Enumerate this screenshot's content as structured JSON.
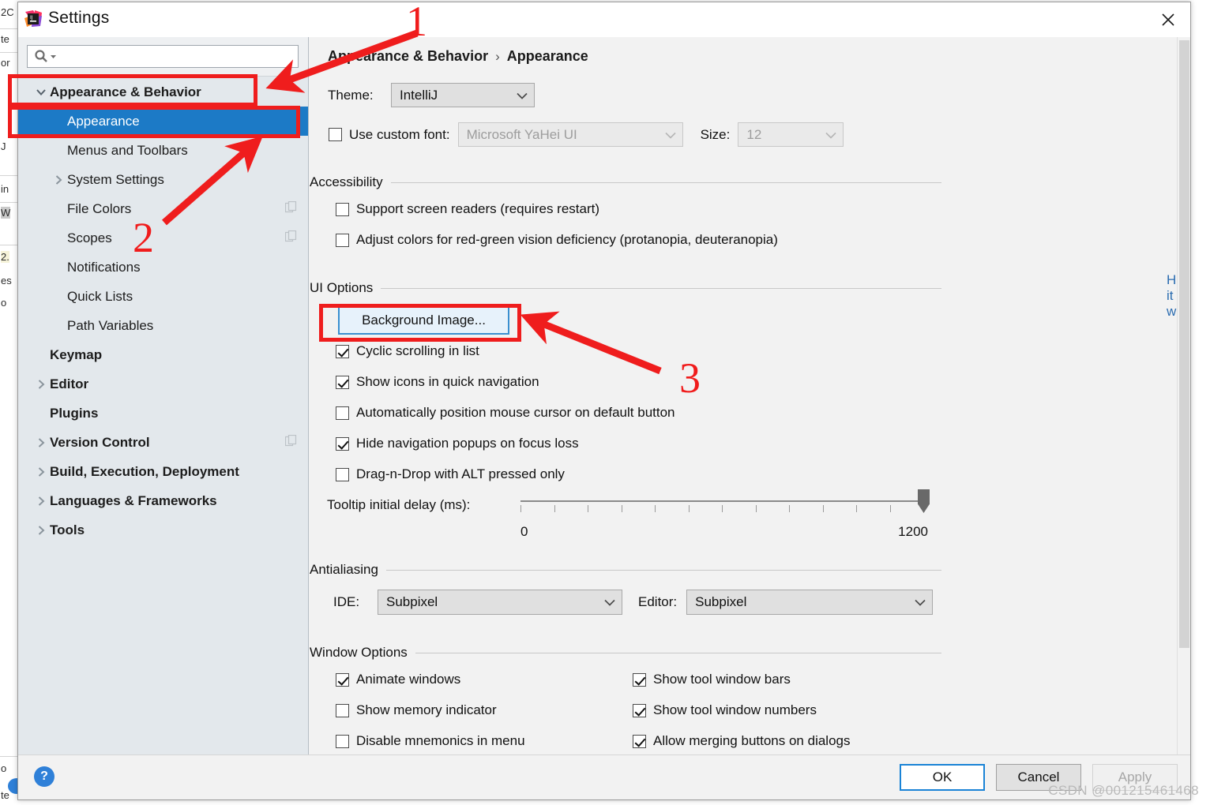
{
  "window": {
    "title": "Settings",
    "logo_icon": "intellij-idea-logo",
    "close_icon": "close-icon"
  },
  "search": {
    "value": "",
    "placeholder": "",
    "icon": "search-icon",
    "dropdown_icon": "chevron-down-icon"
  },
  "sidebar": {
    "items": [
      {
        "label": "Appearance & Behavior",
        "level": 1,
        "twisty": "expanded",
        "bold": true,
        "selected": false,
        "copy_icon": false
      },
      {
        "label": "Appearance",
        "level": 2,
        "twisty": "none",
        "bold": false,
        "selected": true,
        "copy_icon": false
      },
      {
        "label": "Menus and Toolbars",
        "level": 2,
        "twisty": "none",
        "bold": false,
        "selected": false,
        "copy_icon": false
      },
      {
        "label": "System Settings",
        "level": 2,
        "twisty": "collapsed",
        "bold": false,
        "selected": false,
        "copy_icon": false
      },
      {
        "label": "File Colors",
        "level": 2,
        "twisty": "none",
        "bold": false,
        "selected": false,
        "copy_icon": true
      },
      {
        "label": "Scopes",
        "level": 2,
        "twisty": "none",
        "bold": false,
        "selected": false,
        "copy_icon": true
      },
      {
        "label": "Notifications",
        "level": 2,
        "twisty": "none",
        "bold": false,
        "selected": false,
        "copy_icon": false
      },
      {
        "label": "Quick Lists",
        "level": 2,
        "twisty": "none",
        "bold": false,
        "selected": false,
        "copy_icon": false
      },
      {
        "label": "Path Variables",
        "level": 2,
        "twisty": "none",
        "bold": false,
        "selected": false,
        "copy_icon": false
      },
      {
        "label": "Keymap",
        "level": 1,
        "twisty": "none",
        "bold": true,
        "selected": false,
        "copy_icon": false
      },
      {
        "label": "Editor",
        "level": 1,
        "twisty": "collapsed",
        "bold": true,
        "selected": false,
        "copy_icon": false
      },
      {
        "label": "Plugins",
        "level": 1,
        "twisty": "none",
        "bold": true,
        "selected": false,
        "copy_icon": false
      },
      {
        "label": "Version Control",
        "level": 1,
        "twisty": "collapsed",
        "bold": true,
        "selected": false,
        "copy_icon": true
      },
      {
        "label": "Build, Execution, Deployment",
        "level": 1,
        "twisty": "collapsed",
        "bold": true,
        "selected": false,
        "copy_icon": false
      },
      {
        "label": "Languages & Frameworks",
        "level": 1,
        "twisty": "collapsed",
        "bold": true,
        "selected": false,
        "copy_icon": false
      },
      {
        "label": "Tools",
        "level": 1,
        "twisty": "collapsed",
        "bold": true,
        "selected": false,
        "copy_icon": false
      }
    ]
  },
  "breadcrumb": {
    "parent": "Appearance & Behavior",
    "separator": "›",
    "current": "Appearance"
  },
  "theme": {
    "label": "Theme:",
    "value": "IntelliJ"
  },
  "custom_font": {
    "checkbox_label": "Use custom font:",
    "checked": false,
    "font_value": "Microsoft YaHei UI",
    "size_label": "Size:",
    "size_value": "12",
    "disabled": true
  },
  "accessibility": {
    "title": "Accessibility",
    "options": [
      {
        "label": "Support screen readers (requires restart)",
        "checked": false
      },
      {
        "label": "Adjust colors for red-green vision deficiency (protanopia, deuteranopia)",
        "checked": false
      }
    ],
    "link": "How it works"
  },
  "ui_options": {
    "title": "UI Options",
    "background_image_button": "Background Image...",
    "options": [
      {
        "label": "Cyclic scrolling in list",
        "checked": true
      },
      {
        "label": "Show icons in quick navigation",
        "checked": true
      },
      {
        "label": "Automatically position mouse cursor on default button",
        "checked": false
      },
      {
        "label": "Hide navigation popups on focus loss",
        "checked": true
      },
      {
        "label": "Drag-n-Drop with ALT pressed only",
        "checked": false
      }
    ],
    "tooltip_delay": {
      "label": "Tooltip initial delay (ms):",
      "min_label": "0",
      "max_label": "1200",
      "min": 0,
      "max": 1200,
      "value": 1200,
      "tick_count": 13
    }
  },
  "antialiasing": {
    "title": "Antialiasing",
    "ide_label": "IDE:",
    "ide_value": "Subpixel",
    "editor_label": "Editor:",
    "editor_value": "Subpixel"
  },
  "window_options": {
    "title": "Window Options",
    "left_column": [
      {
        "label": "Animate windows",
        "checked": true
      },
      {
        "label": "Show memory indicator",
        "checked": false
      },
      {
        "label": "Disable mnemonics in menu",
        "checked": false
      }
    ],
    "right_column": [
      {
        "label": "Show tool window bars",
        "checked": true
      },
      {
        "label": "Show tool window numbers",
        "checked": true
      },
      {
        "label": "Allow merging buttons on dialogs",
        "checked": true
      }
    ]
  },
  "footer": {
    "help_label": "?",
    "ok": "OK",
    "cancel": "Cancel",
    "apply": "Apply"
  },
  "annotations": {
    "numbers": [
      "1",
      "2",
      "3"
    ],
    "color": "#ef1d1d"
  },
  "watermark": "CSDN @001215461468",
  "background_ide": {
    "lines": [
      "2C",
      "te",
      "or",
      "J",
      "in",
      "W",
      "2.",
      "es",
      "o",
      "o",
      "te"
    ]
  },
  "colors": {
    "accent_selection": "#1c7ac6",
    "annotation_red": "#ef1d1d",
    "link_blue": "#2b6cb0",
    "sidebar_bg": "#e3e8ec",
    "panel_bg": "#f2f2f2"
  }
}
